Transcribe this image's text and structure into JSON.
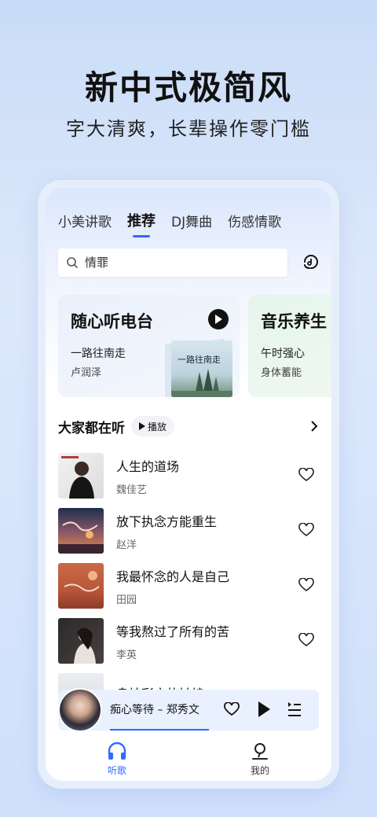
{
  "promo": {
    "headline": "新中式极简风",
    "subline": "字大清爽，长辈操作零门槛"
  },
  "tabs": [
    {
      "label": "小美讲歌",
      "active": false
    },
    {
      "label": "推荐",
      "active": true
    },
    {
      "label": "DJ舞曲",
      "active": false
    },
    {
      "label": "伤感情歌",
      "active": false
    }
  ],
  "search": {
    "placeholder": "情罪"
  },
  "cards": {
    "radio": {
      "title": "随心听电台",
      "song": "一路往南走",
      "artist": "卢润泽",
      "cover_text": "一路往南走"
    },
    "health": {
      "title": "音乐养生",
      "line1": "午时强心",
      "line2": "身体蓄能"
    }
  },
  "section": {
    "title": "大家都在听",
    "play_all": "播放"
  },
  "songs": [
    {
      "name": "人生的道场",
      "artist": "魏佳艺"
    },
    {
      "name": "放下执念方能重生",
      "artist": "赵洋"
    },
    {
      "name": "我最怀念的人是自己",
      "artist": "田园"
    },
    {
      "name": "等我熬过了所有的苦",
      "artist": "李英"
    },
    {
      "name": "身披彩衣的姑娘",
      "artist": ""
    }
  ],
  "player": {
    "now_playing": "痴心等待 – 郑秀文",
    "progress": 0.38
  },
  "nav": [
    {
      "label": "听歌",
      "active": true,
      "icon": "headphones-icon"
    },
    {
      "label": "我的",
      "active": false,
      "icon": "profile-icon"
    }
  ],
  "colors": {
    "accent": "#2f6bff",
    "background": "#d8e5fa"
  }
}
